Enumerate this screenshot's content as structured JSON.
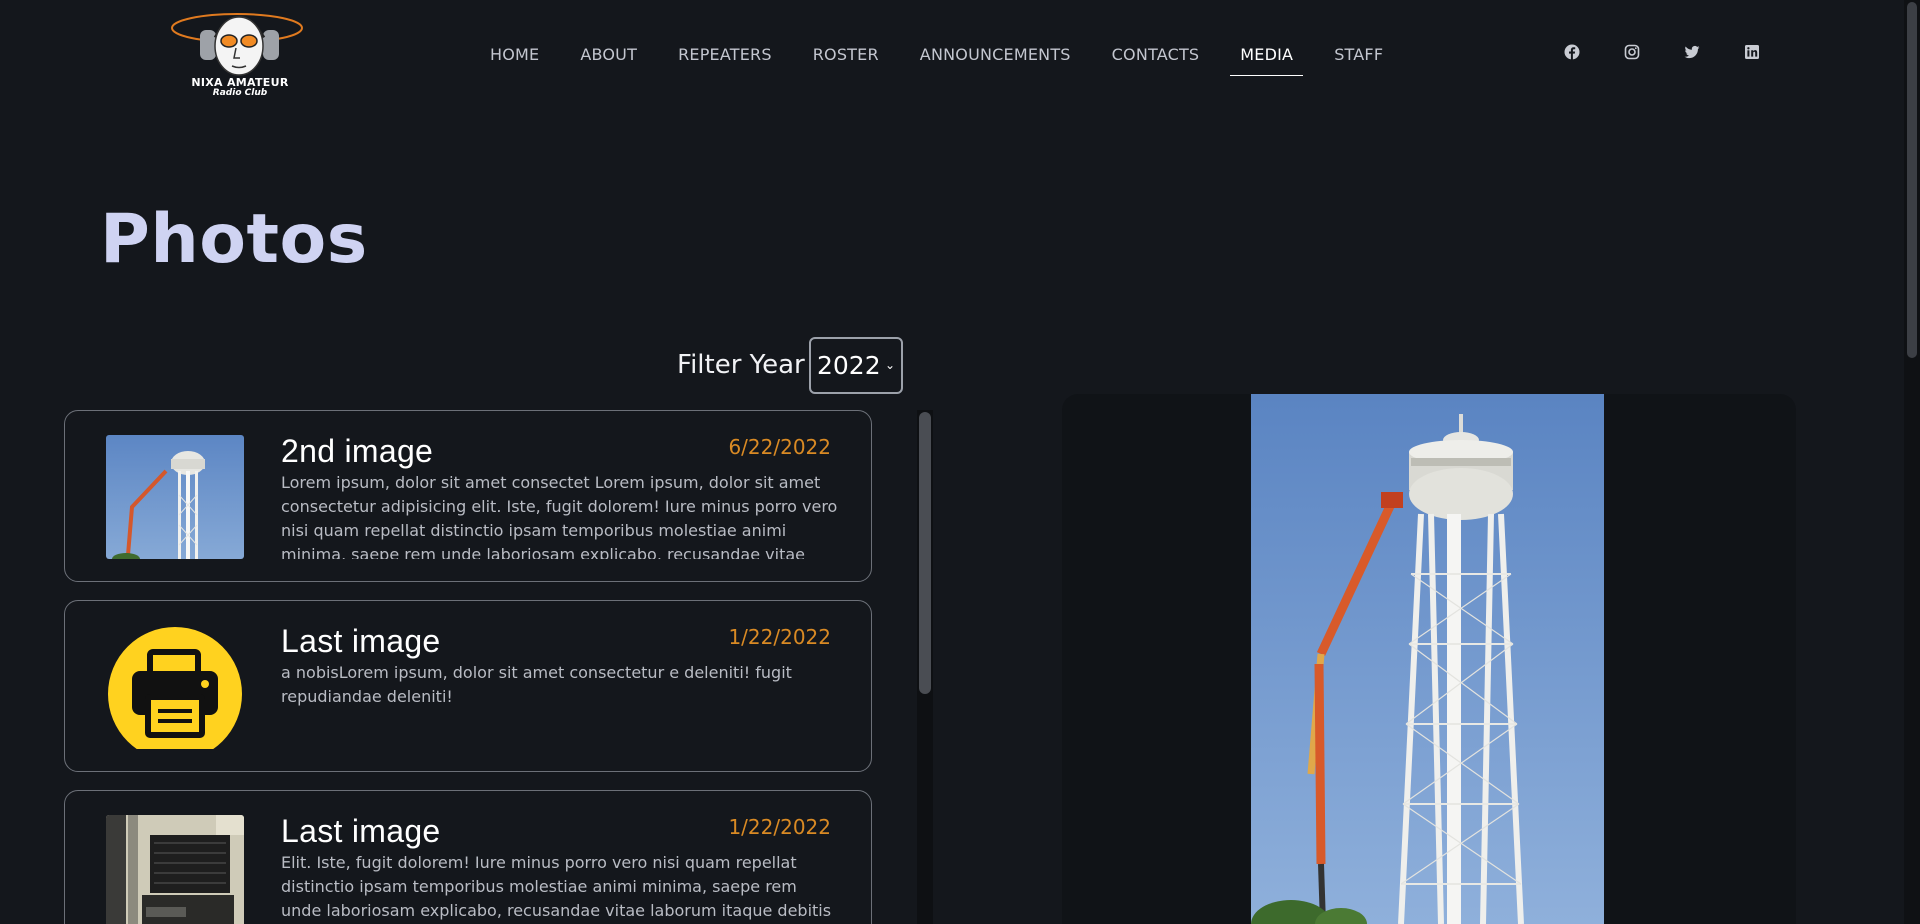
{
  "logo": {
    "line1": "NIXA AMATEUR",
    "line2": "Radio Club"
  },
  "nav": {
    "items": [
      "HOME",
      "ABOUT",
      "REPEATERS",
      "ROSTER",
      "ANNOUNCEMENTS",
      "CONTACTS",
      "MEDIA",
      "STAFF"
    ],
    "active": "MEDIA"
  },
  "social": [
    "facebook-icon",
    "instagram-icon",
    "twitter-icon",
    "linkedin-icon"
  ],
  "page": {
    "title": "Photos"
  },
  "filter": {
    "label": "Filter Year",
    "selected": "2022"
  },
  "cards": [
    {
      "title": "2nd image",
      "date": "6/22/2022",
      "description": "Lorem ipsum, dolor sit amet consectet Lorem ipsum, dolor sit amet consectetur adipisicing elit. Iste, fugit dolorem! Iure minus porro vero nisi quam repellat distinctio ipsam temporibus molestiae animi minima, saepe rem unde laboriosam explicabo, recusandae vitae",
      "thumbnail": "water-tower-photo"
    },
    {
      "title": "Last image",
      "date": "1/22/2022",
      "description": "a nobisLorem ipsum, dolor sit amet consectetur e deleniti! fugit repudiandae deleniti!",
      "thumbnail": "printer-icon"
    },
    {
      "title": "Last image",
      "date": "1/22/2022",
      "description": "Elit. Iste, fugit dolorem! Iure minus porro vero nisi quam repellat distinctio ipsam temporibus molestiae animi minima, saepe rem unde laboriosam explicabo, recusandae vitae laborum itaque debitis",
      "thumbnail": "equipment-rack-photo"
    }
  ],
  "colors": {
    "background": "#14171c",
    "title": "#cfd3f2",
    "date": "#d98a24",
    "printer_yellow": "#ffd21f"
  }
}
